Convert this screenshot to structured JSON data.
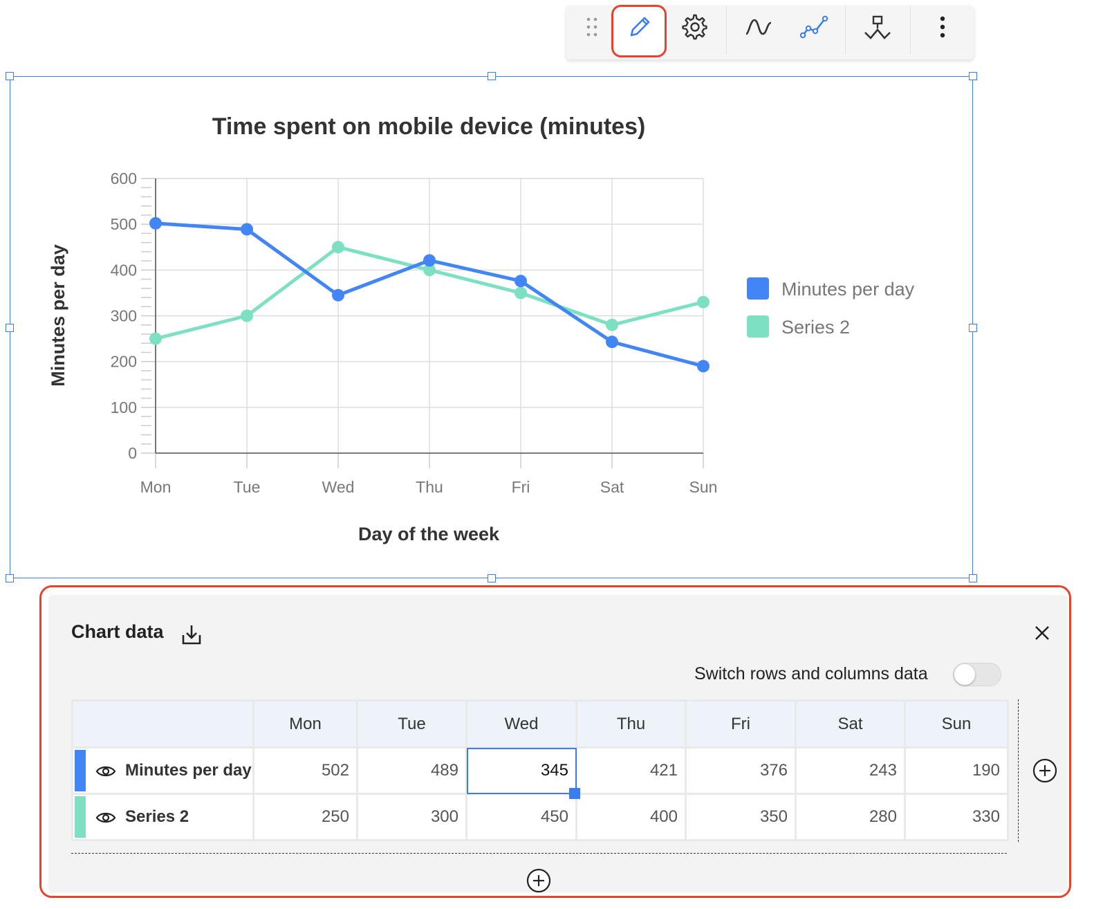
{
  "toolbar": {
    "items": [
      {
        "icon": "drag-handle-icon"
      },
      {
        "icon": "pencil-icon",
        "active": true
      },
      {
        "icon": "gear-icon"
      },
      {
        "icon": "smooth-curve-icon"
      },
      {
        "icon": "line-markers-icon"
      },
      {
        "icon": "step-line-icon"
      },
      {
        "icon": "more-vertical-icon"
      }
    ]
  },
  "chart_data": {
    "type": "line",
    "title": "Time spent on mobile device (minutes)",
    "xlabel": "Day of the week",
    "ylabel": "Minutes per day",
    "categories": [
      "Mon",
      "Tue",
      "Wed",
      "Thu",
      "Fri",
      "Sat",
      "Sun"
    ],
    "yticks": [
      "0",
      "100",
      "200",
      "300",
      "400",
      "500",
      "600"
    ],
    "ylim": [
      0,
      600
    ],
    "grid": true,
    "legend_position": "right",
    "series": [
      {
        "name": "Minutes per day",
        "color": "#4285f4",
        "values": [
          502,
          489,
          345,
          421,
          376,
          243,
          190
        ]
      },
      {
        "name": "Series 2",
        "color": "#7ee0c3",
        "values": [
          250,
          300,
          450,
          400,
          350,
          280,
          330
        ]
      }
    ]
  },
  "panel": {
    "title": "Chart data",
    "switch_label": "Switch rows and columns data",
    "switch_on": false,
    "columns": [
      "Mon",
      "Tue",
      "Wed",
      "Thu",
      "Fri",
      "Sat",
      "Sun"
    ],
    "rows": [
      {
        "label": "Minutes per day",
        "color": "#4285f4",
        "cells": [
          "502",
          "489",
          "345",
          "421",
          "376",
          "243",
          "190"
        ]
      },
      {
        "label": "Series 2",
        "color": "#7ee0c3",
        "cells": [
          "250",
          "300",
          "450",
          "400",
          "350",
          "280",
          "330"
        ]
      }
    ]
  }
}
